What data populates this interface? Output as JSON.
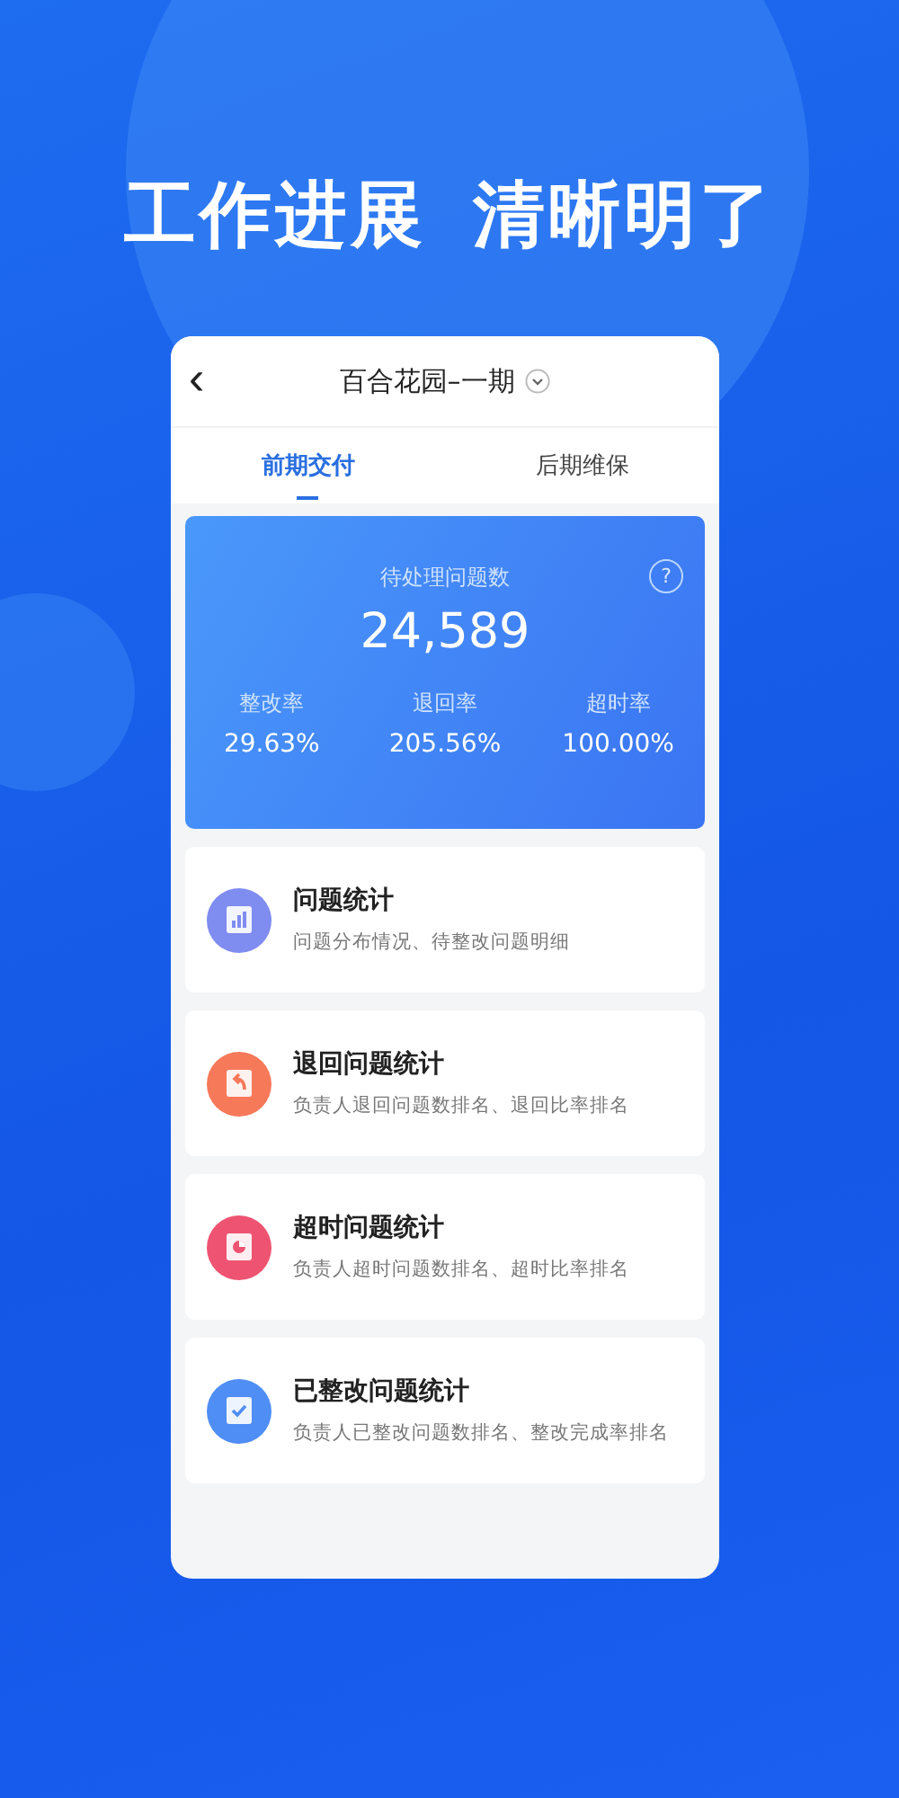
{
  "headline": {
    "left": "工作进展",
    "right": "清晰明了"
  },
  "header": {
    "back": "‹",
    "title": "百合花园–一期"
  },
  "tabs": [
    {
      "label": "前期交付",
      "selected": true
    },
    {
      "label": "后期维保",
      "selected": false
    }
  ],
  "summary": {
    "label": "待处理问题数",
    "help": "?",
    "value": "24,589",
    "stats": [
      {
        "label": "整改率",
        "value": "29.63%"
      },
      {
        "label": "退回率",
        "value": "205.56%"
      },
      {
        "label": "超时率",
        "value": "100.00%"
      }
    ]
  },
  "items": [
    {
      "kind": "chart",
      "color": "#7f8cf0",
      "title": "问题统计",
      "subtitle": "问题分布情况、待整改问题明细"
    },
    {
      "kind": "return",
      "color": "#f6795a",
      "title": "退回问题统计",
      "subtitle": "负责人退回问题数排名、退回比率排名"
    },
    {
      "kind": "clock",
      "color": "#ee5472",
      "title": "超时问题统计",
      "subtitle": "负责人超时问题数排名、超时比率排名"
    },
    {
      "kind": "check",
      "color": "#4f8ef5",
      "title": "已整改问题统计",
      "subtitle": "负责人已整改问题数排名、整改完成率排名"
    }
  ]
}
